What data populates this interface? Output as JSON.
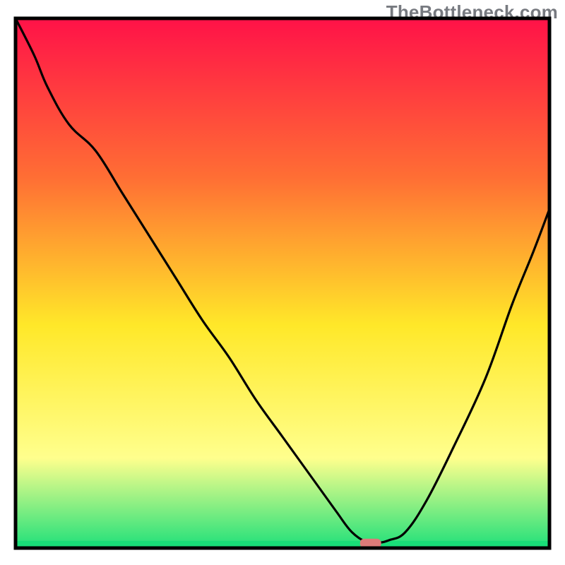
{
  "watermark": "TheBottleneck.com",
  "colors": {
    "frame": "#000000",
    "curve": "#000000",
    "marker_fill": "#dd7b79",
    "gradient_top": "#ff1248",
    "gradient_orange": "#ff6e34",
    "gradient_yellow": "#ffe829",
    "gradient_lightyellow": "#ffff8d",
    "gradient_green": "#1fe07a",
    "bottom_strip": "#19df78"
  },
  "chart_data": {
    "type": "line",
    "title": "TheBottleneck.com",
    "xlabel": "",
    "ylabel": "",
    "xlim": [
      0,
      100
    ],
    "ylim": [
      0,
      100
    ],
    "grid": false,
    "legend": false,
    "annotations": [],
    "note": "V-shaped bottleneck curve; minimum (≈0) near x≈65–68; small marker pill at the valley.",
    "x": [
      0,
      3.5,
      6,
      10,
      15,
      20,
      25,
      30,
      35,
      40,
      45,
      50,
      55,
      60,
      63,
      66,
      68,
      70,
      73,
      77,
      82,
      88,
      93,
      97,
      100
    ],
    "values": [
      100,
      93,
      87,
      80,
      75,
      67,
      59,
      51,
      43,
      36,
      28,
      21,
      14,
      7,
      3,
      1,
      1,
      1.5,
      3,
      9,
      19,
      32,
      46,
      56,
      64
    ],
    "marker": {
      "x": 66.5,
      "y": 0.9,
      "shape": "pill"
    }
  }
}
